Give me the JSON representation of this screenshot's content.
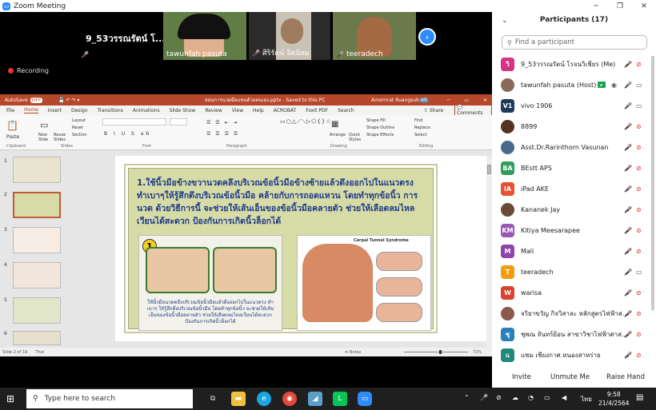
{
  "window": {
    "title": "Zoom Meeting",
    "minimize": "─",
    "maximize": "❐",
    "close": "✕"
  },
  "videos": [
    {
      "name": "9_53วรรณรัตน์ โ...",
      "muted": true
    },
    {
      "name": "tawunfah pasuta",
      "muted": false
    },
    {
      "name": "ศิริรัตน์ จิตนิยม",
      "muted": true
    },
    {
      "name": "teeradech",
      "muted": true
    }
  ],
  "recording": "Recording",
  "ppt": {
    "autosave": "AutoSave",
    "autosave_state": "OFF",
    "filename": "สอนการนวดมือแขนด้วยตนเอง.pptx - Saved to this PC",
    "user": "Amornrat Ruangsukul",
    "user_initials": "AR",
    "tabs": [
      "File",
      "Home",
      "Insert",
      "Design",
      "Transitions",
      "Animations",
      "Slide Show",
      "Review",
      "View",
      "Help",
      "ACROBAT",
      "Foxit PDF",
      "Search"
    ],
    "active_tab": "Home",
    "share": "Share",
    "comments": "Comments",
    "groups": [
      "Clipboard",
      "Slides",
      "Font",
      "Paragraph",
      "Drawing",
      "Editing"
    ],
    "ribbon_buttons": {
      "paste": "Paste",
      "new_slide": "New Slide",
      "reuse": "Reuse Slides",
      "layout": "Layout",
      "reset": "Reset",
      "section": "Section",
      "arrange": "Arrange",
      "quick_styles": "Quick Styles",
      "shape_fill": "Shape Fill",
      "shape_outline": "Shape Outline",
      "shape_effects": "Shape Effects",
      "find": "Find",
      "replace": "Replace",
      "select": "Select"
    },
    "slide_numbers": [
      "1",
      "2",
      "3",
      "4",
      "5",
      "6"
    ],
    "selected_slide": 2,
    "slide": {
      "text": "1.ใช้นิ้วมือข้างขวานวดคลึงบริเวณข้อนิ้วมือข้างซ้ายแล้วดึงออกไปในแนวตรง ทำเบาๆให้รู้สึกตึงบริเวณข้อนิ้วมือ คล้ายกับการถอดแหวน โดยทำทุกข้อนิ้ว การนวด ด้วยวิธีการนี้ จะช่วยให้เส้นเอ็นของข้อนิ้วมือคลายตัว ช่วยให้เลือดลมไหลเวียนได้สะดวก ป้องกันการเกิดนิ้วล็อกได้",
      "badge": "1",
      "caption": "ใช้นิ้วมือนวดคลึงบริเวณข้อนิ้วมือแล้วดึงออกไปในแนวตรง ทำเบาๆ ให้รู้สึกตึงบริเวณข้อนิ้วมือ โดยทำทุกข้อนิ้ว จะช่วยให้เส้นเอ็นของข้อนิ้วมือคลายตัว ช่วยให้เลือดลมไหลเวียนได้สะดวก ป้องกันการเกิดนิ้วล็อกได้",
      "right_title": "Carpal Tunnel Syndrome"
    },
    "status": {
      "slide": "Slide 2 of 19",
      "lang": "Thai",
      "notes": "Notes",
      "zoom": "72%"
    }
  },
  "participants": {
    "title": "Participants (17)",
    "search_placeholder": "Find a participant",
    "list": [
      {
        "initials": "วิ",
        "name": "9_53วรรณรัตน์  โรจนวิเชียร (Me)",
        "color": "#d63384",
        "photo": false,
        "mic": "muted",
        "cam": "off"
      },
      {
        "initials": "",
        "name": "tawunfah pasuta (Host)",
        "color": "#8a6a5a",
        "photo": true,
        "mic": "on",
        "cam": "on",
        "host": true
      },
      {
        "initials": "V1",
        "name": "vivo 1906",
        "color": "#1f3b5b",
        "photo": false,
        "mic": "on",
        "cam": "on"
      },
      {
        "initials": "",
        "name": "8899",
        "color": "#553322",
        "photo": true,
        "mic": "muted",
        "cam": "off"
      },
      {
        "initials": "",
        "name": "Asst.Dr.Rarinthorn Vasunan",
        "color": "#4a6a8a",
        "photo": true,
        "mic": "muted",
        "cam": "off"
      },
      {
        "initials": "BA",
        "name": "BEstt APS",
        "color": "#2f9e5a",
        "photo": false,
        "mic": "muted",
        "cam": "off"
      },
      {
        "initials": "IA",
        "name": "iPad AKE",
        "color": "#e8502f",
        "photo": false,
        "mic": "muted",
        "cam": "off"
      },
      {
        "initials": "",
        "name": "Kananek Jay",
        "color": "#6b4a3a",
        "photo": true,
        "mic": "muted",
        "cam": "off"
      },
      {
        "initials": "KM",
        "name": "Kitiya Meesarapee",
        "color": "#9b59b6",
        "photo": false,
        "mic": "muted",
        "cam": "off"
      },
      {
        "initials": "M",
        "name": "Mali",
        "color": "#8e44ad",
        "photo": false,
        "mic": "muted",
        "cam": "off"
      },
      {
        "initials": "T",
        "name": "teeradech",
        "color": "#f39c12",
        "photo": false,
        "mic": "muted",
        "cam": "on"
      },
      {
        "initials": "W",
        "name": "warisa",
        "color": "#d9432f",
        "photo": false,
        "mic": "muted",
        "cam": "off"
      },
      {
        "initials": "",
        "name": "จริยาขวัญ กิจวิสาละ หลักสูตรไฟฟ้าส...",
        "color": "#8a5a4a",
        "photo": true,
        "mic": "muted",
        "cam": "off"
      },
      {
        "initials": "ชุ",
        "name": "ชุพณ  จันทร์ย้อน สาขาวิชาไฟฟ้าศาส...",
        "color": "#2a7fbf",
        "photo": false,
        "mic": "muted",
        "cam": "off"
      },
      {
        "initials": "แ",
        "name": "แชม เชียงกาศ.หนองสาหร่าย",
        "color": "#1f8a7a",
        "photo": false,
        "mic": "muted",
        "cam": "off"
      }
    ],
    "invite": "Invite",
    "unmute": "Unmute Me",
    "raise": "Raise Hand"
  },
  "taskbar": {
    "search": "Type here to search",
    "time": "9:58",
    "date": "21/4/2564",
    "lang": "ไทย"
  }
}
